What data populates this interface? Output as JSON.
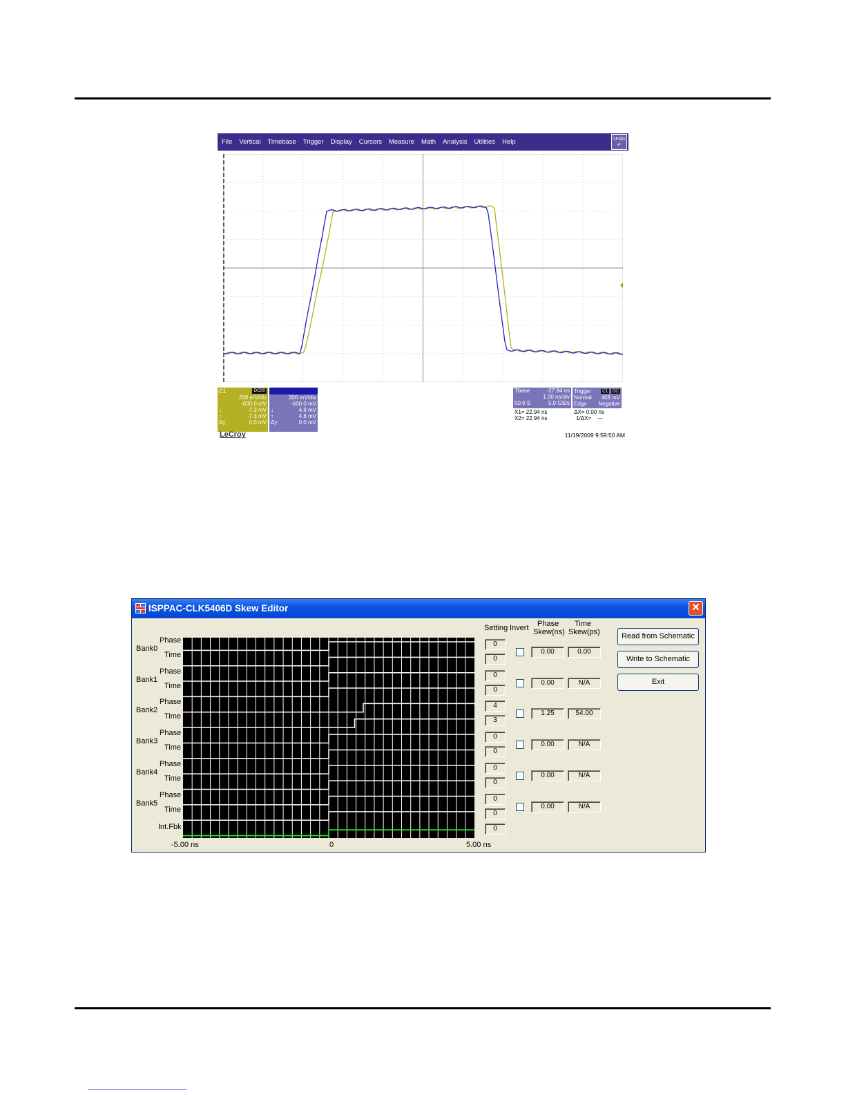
{
  "scope": {
    "menu": [
      "File",
      "Vertical",
      "Timebase",
      "Trigger",
      "Display",
      "Cursors",
      "Measure",
      "Math",
      "Analysis",
      "Utilities",
      "Help"
    ],
    "undo_label": "Undo",
    "c1": {
      "name": "C1",
      "coupling": "DC50",
      "rows": [
        [
          "",
          "200 mV/div"
        ],
        [
          "",
          "-600.0 mV"
        ],
        [
          "↓",
          "-7.3 mV"
        ],
        [
          "↑",
          "-7.3 mV"
        ],
        [
          "Δy",
          "0.0 mV"
        ]
      ]
    },
    "c2": {
      "name": "",
      "coupling": "",
      "rows": [
        [
          "",
          "200 mV/div"
        ],
        [
          "",
          "-600.0 mV"
        ],
        [
          "↓",
          "4.8 mV"
        ],
        [
          "↑",
          "4.8 mV"
        ],
        [
          "Δy",
          "0.0 mV"
        ]
      ]
    },
    "timebase": {
      "label": "Tbase",
      "offset": "-27.94 ns",
      "div": "1.00 ns/div",
      "samples": "50.0 S",
      "rate": "5.0 GS/s"
    },
    "trigger": {
      "label": "Trigger",
      "ch": "C1",
      "cp": "DC",
      "mode": "Normal",
      "level": "468 mV",
      "type": "Edge",
      "slope": "Negative"
    },
    "cursors": {
      "x1_label": "X1=",
      "x1": "22.94 ns",
      "dx_label": "ΔX=",
      "dx": "0.00 ns",
      "x2_label": "X2=",
      "x2": "22.94 ns",
      "inv_label": "1/ΔX=",
      "inv": "---"
    },
    "brand": "LeCroy",
    "timestamp": "11/19/2009 9:59:50 AM",
    "traces": {
      "c1_color": "#b5b023",
      "c2_color": "#2020c0"
    }
  },
  "skew_editor": {
    "title": "ISPPAC-CLK5406D Skew Editor",
    "headers": {
      "setting": "Setting",
      "invert": "Invert",
      "phase_skew": [
        "Phase",
        "Skew(ns)"
      ],
      "time_skew": [
        "Time",
        "Skew(ps)"
      ]
    },
    "axis": {
      "left": "-5.00 ns",
      "mid": "0",
      "right": "5.00 ns"
    },
    "row_labels": {
      "phase": "Phase",
      "time": "Time"
    },
    "banks": [
      {
        "name": "Bank0",
        "phase_setting": "0",
        "time_setting": "0",
        "phase_skew": "0.00",
        "time_skew": "0.00"
      },
      {
        "name": "Bank1",
        "phase_setting": "0",
        "time_setting": "0",
        "phase_skew": "0.00",
        "time_skew": "N/A"
      },
      {
        "name": "Bank2",
        "phase_setting": "4",
        "time_setting": "3",
        "phase_skew": "1.25",
        "time_skew": "54.00"
      },
      {
        "name": "Bank3",
        "phase_setting": "0",
        "time_setting": "0",
        "phase_skew": "0.00",
        "time_skew": "N/A"
      },
      {
        "name": "Bank4",
        "phase_setting": "0",
        "time_setting": "0",
        "phase_skew": "0.00",
        "time_skew": "N/A"
      },
      {
        "name": "Bank5",
        "phase_setting": "0",
        "time_setting": "0",
        "phase_skew": "0.00",
        "time_skew": "N/A"
      }
    ],
    "intfbk": {
      "label": "Int.Fbk",
      "setting": "0"
    },
    "buttons": {
      "read": "Read from Schematic",
      "write": "Write to Schematic",
      "exit": "Exit"
    },
    "colors": {
      "clock_line": "#ffffff",
      "feedback_line": "#22dd22",
      "grid": "#ffffff"
    }
  }
}
